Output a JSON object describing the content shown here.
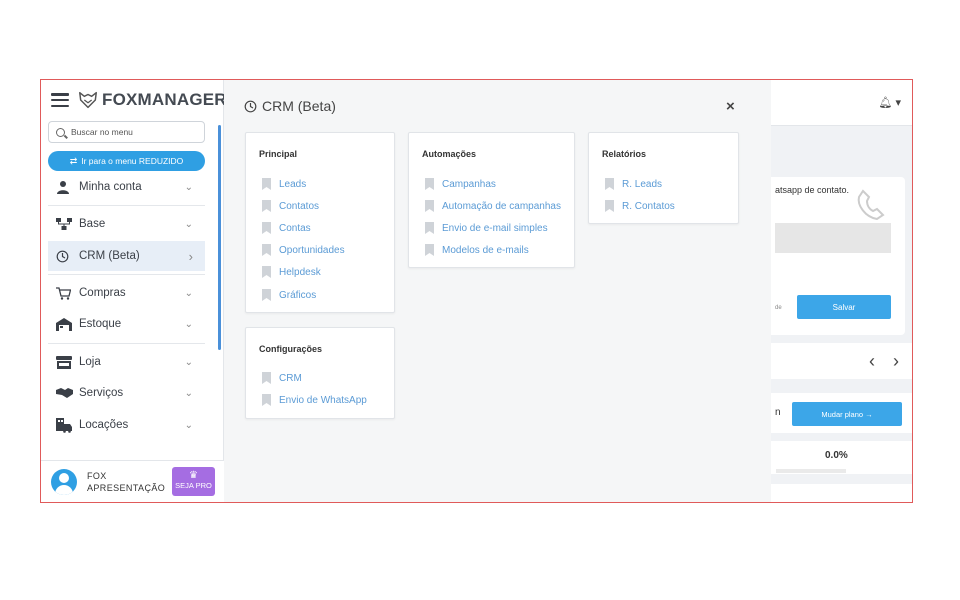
{
  "sidebar": {
    "logo_text": "FOXMANAGER",
    "search_placeholder": "Buscar no menu",
    "reduce_button": "Ir para o menu REDUZIDO",
    "items": [
      {
        "label": "Minha conta",
        "icon": "user-icon",
        "chevron": "⌄"
      },
      {
        "label": "Base",
        "icon": "hierarchy-icon",
        "chevron": "⌄"
      },
      {
        "label": "CRM (Beta)",
        "icon": "crm-icon",
        "chevron": "›",
        "active": true
      },
      {
        "label": "Compras",
        "icon": "cart-icon",
        "chevron": "⌄"
      },
      {
        "label": "Estoque",
        "icon": "warehouse-icon",
        "chevron": "⌄"
      },
      {
        "label": "Loja",
        "icon": "store-icon",
        "chevron": "⌄"
      },
      {
        "label": "Serviços",
        "icon": "handshake-icon",
        "chevron": "⌄"
      },
      {
        "label": "Locações",
        "icon": "car-building-icon",
        "chevron": "⌄"
      }
    ],
    "user": {
      "name_line1": "FOX",
      "name_line2": "APRESENTAÇÃO",
      "pro_label": "SEJA PRO"
    }
  },
  "crm": {
    "title": "CRM (Beta)",
    "close": "×",
    "cards": {
      "principal": {
        "title": "Principal",
        "links": [
          "Leads",
          "Contatos",
          "Contas",
          "Oportunidades",
          "Helpdesk",
          "Gráficos"
        ]
      },
      "automacoes": {
        "title": "Automações",
        "links": [
          "Campanhas",
          "Automação de campanhas",
          "Envio de e-mail simples",
          "Modelos de e-mails"
        ]
      },
      "relatorios": {
        "title": "Relatórios",
        "links": [
          "R. Leads",
          "R. Contatos"
        ]
      },
      "configuracoes": {
        "title": "Configurações",
        "links": [
          "CRM",
          "Envio de WhatsApp"
        ]
      }
    }
  },
  "background": {
    "whatsapp_text": "atsapp de contato.",
    "tiny_text": "de",
    "save_button": "Salvar",
    "plan_letter": "n",
    "change_plan_button": "Mudar plano  →",
    "percent": "0.0%"
  },
  "colors": {
    "accent": "#2f9fe3",
    "link": "#5b9bd5",
    "pro": "#a56de2",
    "frame_border": "#e05a5a"
  }
}
